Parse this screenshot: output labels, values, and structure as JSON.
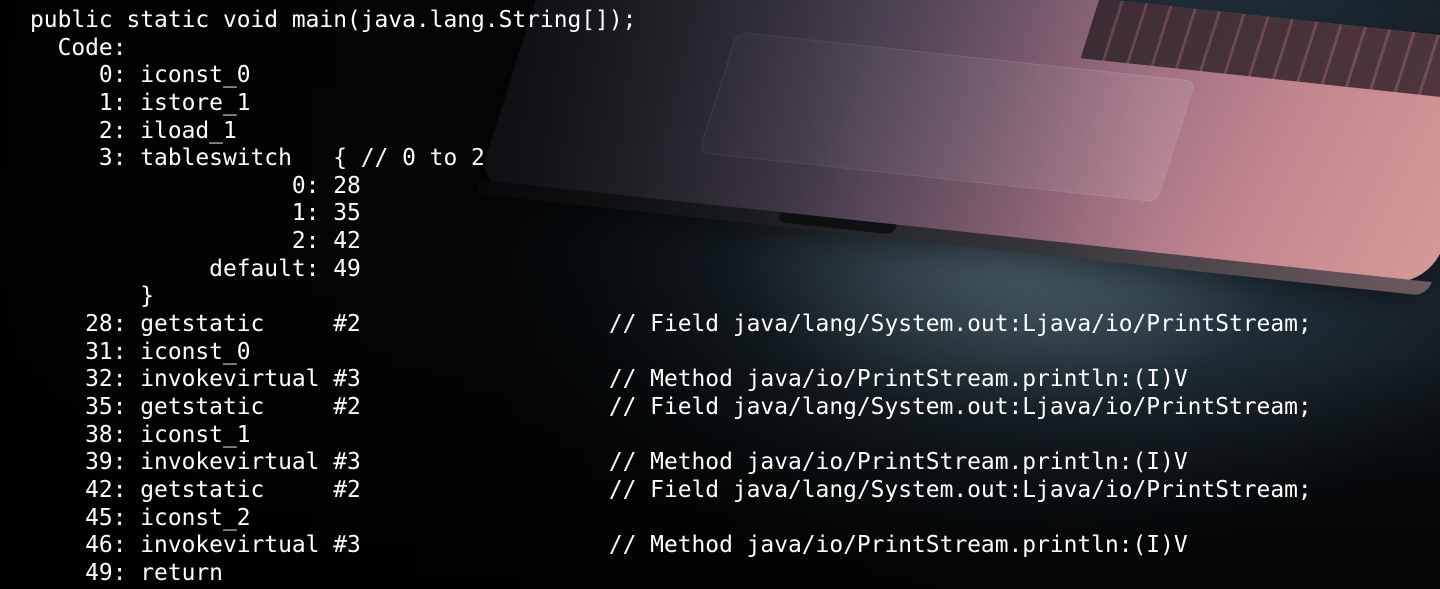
{
  "background": {
    "description_icon": "laptop-photo",
    "colors": {
      "base": "#000000",
      "glow": "#8aa9b9",
      "laptop_highlight": "#d79898"
    }
  },
  "code_listing": {
    "text_color": "#ffffff",
    "lines": [
      "public static void main(java.lang.String[]);",
      "  Code:",
      "     0: iconst_0",
      "     1: istore_1",
      "     2: iload_1",
      "     3: tableswitch   { // 0 to 2",
      "                   0: 28",
      "                   1: 35",
      "                   2: 42",
      "             default: 49",
      "        }",
      "    28: getstatic     #2                  // Field java/lang/System.out:Ljava/io/PrintStream;",
      "    31: iconst_0",
      "    32: invokevirtual #3                  // Method java/io/PrintStream.println:(I)V",
      "    35: getstatic     #2                  // Field java/lang/System.out:Ljava/io/PrintStream;",
      "    38: iconst_1",
      "    39: invokevirtual #3                  // Method java/io/PrintStream.println:(I)V",
      "    42: getstatic     #2                  // Field java/lang/System.out:Ljava/io/PrintStream;",
      "    45: iconst_2",
      "    46: invokevirtual #3                  // Method java/io/PrintStream.println:(I)V",
      "    49: return"
    ]
  }
}
